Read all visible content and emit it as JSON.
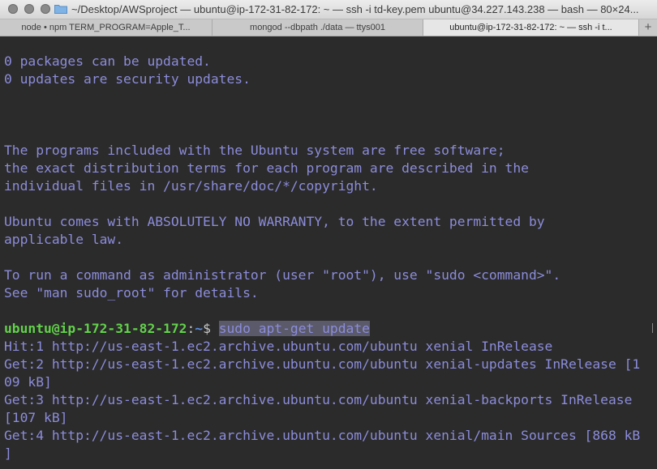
{
  "window": {
    "title": "~/Desktop/AWSproject — ubuntu@ip-172-31-82-172: ~ — ssh -i td-key.pem ubuntu@34.227.143.238 — bash — 80×24..."
  },
  "tabs": [
    {
      "label": "node • npm TERM_PROGRAM=Apple_T..."
    },
    {
      "label": "mongod --dbpath ./data — ttys001"
    },
    {
      "label": "ubuntu@ip-172-31-82-172: ~ — ssh -i t..."
    }
  ],
  "tab_add_label": "+",
  "terminal": {
    "lines_before_prompt": [
      "0 packages can be updated.",
      "0 updates are security updates.",
      "",
      "",
      "",
      "The programs included with the Ubuntu system are free software;",
      "the exact distribution terms for each program are described in the",
      "individual files in /usr/share/doc/*/copyright.",
      "",
      "Ubuntu comes with ABSOLUTELY NO WARRANTY, to the extent permitted by",
      "applicable law.",
      "",
      "To run a command as administrator (user \"root\"), use \"sudo <command>\".",
      "See \"man sudo_root\" for details.",
      ""
    ],
    "prompt": {
      "user_host": "ubuntu@ip-172-31-82-172",
      "separator": ":",
      "path": "~",
      "symbol": "$ ",
      "command": "sudo apt-get update"
    },
    "lines_after_prompt": [
      "Hit:1 http://us-east-1.ec2.archive.ubuntu.com/ubuntu xenial InRelease",
      "Get:2 http://us-east-1.ec2.archive.ubuntu.com/ubuntu xenial-updates InRelease [1",
      "09 kB]",
      "Get:3 http://us-east-1.ec2.archive.ubuntu.com/ubuntu xenial-backports InRelease",
      "[107 kB]",
      "Get:4 http://us-east-1.ec2.archive.ubuntu.com/ubuntu xenial/main Sources [868 kB",
      "]"
    ]
  },
  "colors": {
    "terminal_background": "#2b2b2b",
    "terminal_text": "#8c8cdb",
    "prompt_user": "#62d24a",
    "prompt_path": "#5d8de0"
  }
}
